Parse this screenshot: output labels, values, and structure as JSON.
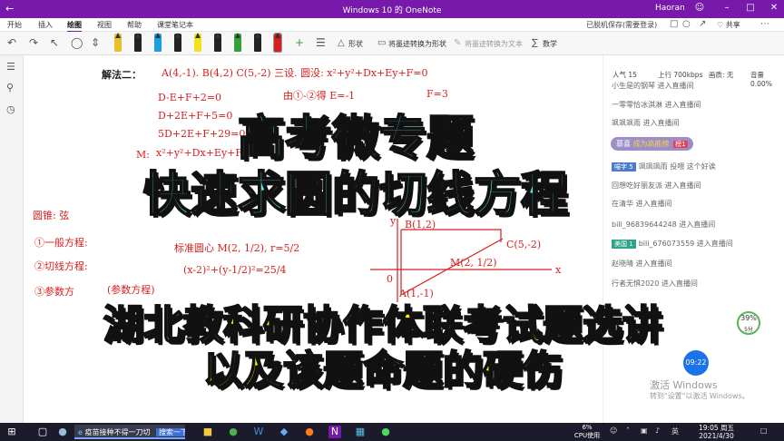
{
  "window": {
    "title": "Windows 10 的 OneNote",
    "user": "Haoran"
  },
  "ribbon": {
    "tabs": [
      "开始",
      "插入",
      "绘图",
      "视图",
      "帮助",
      "课堂笔记本"
    ],
    "active_tab": "绘图",
    "status": "已脱机保存(需要登录)",
    "share": "共享"
  },
  "toolbar": {
    "shape": "形状",
    "ink_to_shape": "将墨迹转换为形状",
    "ink_to_text": "将墨迹转换为文本",
    "math": "数学"
  },
  "pen_colors": [
    "#e8c02a",
    "#222222",
    "#1aa0e0",
    "#222222",
    "#f2e21a",
    "#222222",
    "#33a03a",
    "#222222",
    "#d62020"
  ],
  "notes": {
    "method": "解法二：",
    "line1": "A(4,-1). B(4,2) C(5,-2) 三设. 圆没: x²+y²+Dx+Ey+F=0",
    "eq1": "D-E+F+2=0",
    "eq2": "D+2E+F+5=0",
    "eq3": "5D+2E+F+29=0",
    "step1": "由①-②得  E=-1",
    "step2": "F=3",
    "circ": "x²+y²+Dx+Ey+F",
    "m": "M:",
    "yuan": "圆锥: 弦",
    "s1": "①一般方程:",
    "s2": "②切线方程:",
    "s3": "③参数方",
    "s4": "(参数方程)",
    "center": "标准圆心 M(2, 1/2),  r=5/2",
    "std": "(x-2)²+(y-1/2)²=25/4",
    "pB": "B(1,2)",
    "pC": "C(5,-2)",
    "pM": "M(2, 1/2)",
    "pA": "A(1,-1)",
    "axis_y": "y",
    "axis_x": "x",
    "origin": "0"
  },
  "overlay": {
    "line1": "高考微专题",
    "line2": "快速求圆的切线方程",
    "line3": "湖北教科研协作体联考试题选讲",
    "line4": "以及该题命题的硬伤"
  },
  "chat": {
    "popularity": "人气  15",
    "upload": "上行 700kbps",
    "quality": "画质: 无",
    "volume": "音量 0.00%",
    "lines": [
      {
        "text": "小生是的钢琴 进入直播间"
      },
      {
        "text": "一零零恰冰淇淋 进入直播间"
      },
      {
        "text": "飒飒飒雨 进入直播间"
      },
      {
        "text": "飒飒飒雨 投喂 这个好诶",
        "badge": "喵字 5"
      },
      {
        "text": "回想吃好丽友派 进入直播间"
      },
      {
        "text": "在清华 进入直播间"
      },
      {
        "text": "bili_96839644248 进入直播间"
      },
      {
        "text": "bili_676073559 进入直播间",
        "badge": "美国 1"
      },
      {
        "text": "赵晓晴 进入直播间"
      },
      {
        "text": "行者无惧2020 进入直播间"
      }
    ],
    "pill": {
      "user": "慕喜",
      "gold": "成为高能榜",
      "tag": "榜1"
    },
    "gauge": "39%",
    "gauge_sub": "5分",
    "timer": "09:22",
    "activate_title": "激活 Windows",
    "activate_sub": "转到\"设置\"以激活 Windows。"
  },
  "taskbar": {
    "browser_tab": "疫苗接种不得一刀切",
    "search_btn": "搜索一下",
    "cpu_pct": "6%",
    "cpu_label": "CPU使用",
    "time": "19:05 周五",
    "date": "2021/4/30",
    "ime": "英"
  }
}
